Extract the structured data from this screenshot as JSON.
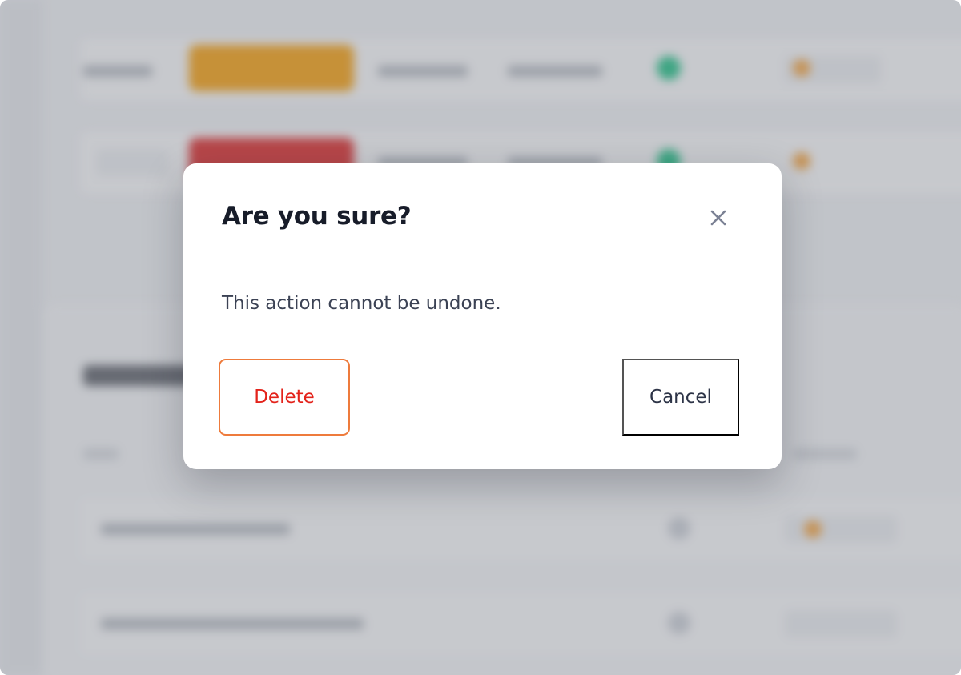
{
  "dialog": {
    "title": "Are you sure?",
    "message": "This action cannot be undone.",
    "close_icon": "close-icon",
    "delete_label": "Delete",
    "cancel_label": "Cancel"
  },
  "colors": {
    "danger_text": "#e3231b",
    "focus_ring": "#ee7b3c",
    "title_text": "#171c29",
    "body_text": "#3b4254",
    "backdrop_status_green": "#1bbf83",
    "backdrop_badge_orange": "#f59e0b",
    "backdrop_badge_red": "#dc2626"
  }
}
